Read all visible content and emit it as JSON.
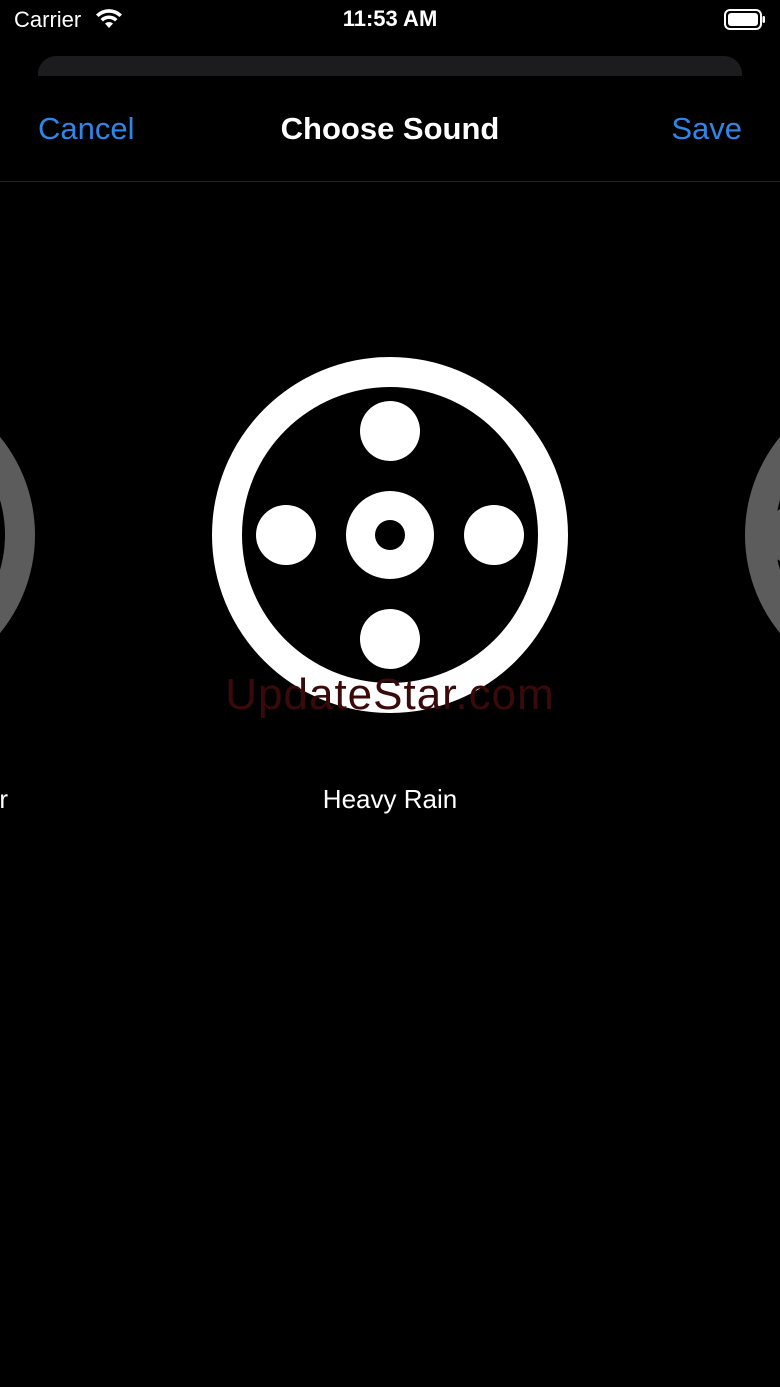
{
  "status_bar": {
    "carrier": "Carrier",
    "time": "11:53 AM"
  },
  "nav": {
    "cancel_label": "Cancel",
    "title": "Choose Sound",
    "save_label": "Save"
  },
  "carousel": {
    "current_sound": "Heavy Rain",
    "previous_sound_partial": "r",
    "watermark": "UpdateStar.com"
  },
  "colors": {
    "accent": "#2f86e8",
    "background": "#000000",
    "icon": "#ffffff"
  },
  "icons": {
    "center": "sound-reel-icon",
    "wifi": "wifi-icon",
    "battery": "battery-icon"
  }
}
